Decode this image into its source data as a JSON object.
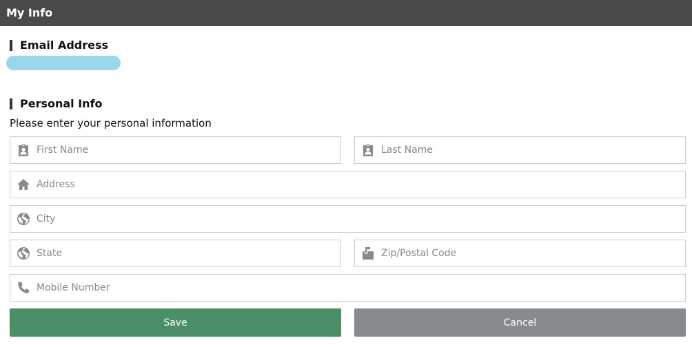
{
  "window": {
    "title": "My Info"
  },
  "email_section": {
    "heading": "Email Address"
  },
  "personal_section": {
    "heading": "Personal Info",
    "instructions": "Please enter your personal information"
  },
  "fields": {
    "first_name": {
      "placeholder": "First Name",
      "icon": "contact-badge-icon",
      "value": ""
    },
    "last_name": {
      "placeholder": "Last Name",
      "icon": "contact-badge-icon",
      "value": ""
    },
    "address": {
      "placeholder": "Address",
      "icon": "home-icon",
      "value": ""
    },
    "city": {
      "placeholder": "City",
      "icon": "globe-icon",
      "value": ""
    },
    "state": {
      "placeholder": "State",
      "icon": "globe-icon",
      "value": ""
    },
    "zip": {
      "placeholder": "Zip/Postal Code",
      "icon": "mailbox-icon",
      "value": ""
    },
    "mobile": {
      "placeholder": "Mobile Number",
      "icon": "phone-icon",
      "value": ""
    }
  },
  "buttons": {
    "save": "Save",
    "cancel": "Cancel"
  },
  "colors": {
    "titlebar": "#4a4a4a",
    "save_button": "#4a8f66",
    "cancel_button": "#888b8e",
    "icon": "#8a8a8a",
    "email_redaction": "#99d8ea"
  }
}
